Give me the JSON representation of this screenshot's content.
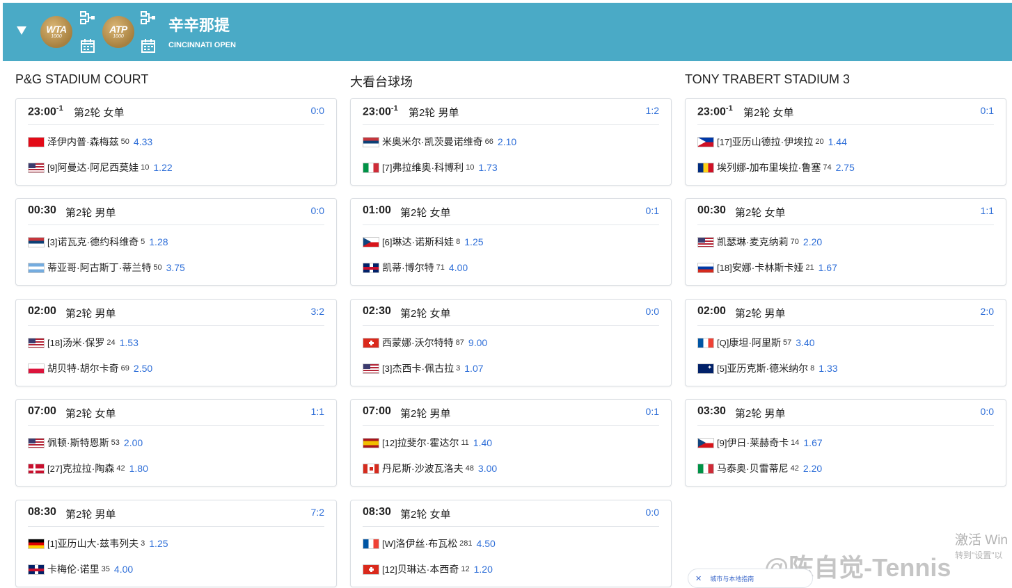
{
  "header": {
    "title": "辛辛那提",
    "subtitle": "CINCINNATI OPEN",
    "badges": [
      {
        "text": "WTA",
        "level": "1000"
      },
      {
        "text": "ATP",
        "level": "1000"
      }
    ]
  },
  "courts": [
    {
      "name": "P&G STADIUM COURT",
      "matches": [
        {
          "time": "23:00",
          "day_offset": "-1",
          "round": "第2轮 女单",
          "score": "0:0",
          "p1": {
            "name": "泽伊内普·森梅兹",
            "seed": "",
            "rank": "50",
            "odds": "4.33",
            "flag": "tr"
          },
          "p2": {
            "name": "阿曼达·阿尼西莫娃",
            "seed": "[9]",
            "rank": "10",
            "odds": "1.22",
            "flag": "us"
          }
        },
        {
          "time": "00:30",
          "day_offset": "",
          "round": "第2轮 男单",
          "score": "0:0",
          "p1": {
            "name": "诺瓦克·德约科维奇",
            "seed": "[3]",
            "rank": "5",
            "odds": "1.28",
            "flag": "rs"
          },
          "p2": {
            "name": "蒂亚哥·阿古斯丁·蒂兰特",
            "seed": "",
            "rank": "50",
            "odds": "3.75",
            "flag": "ar"
          }
        },
        {
          "time": "02:00",
          "day_offset": "",
          "round": "第2轮 男单",
          "score": "3:2",
          "p1": {
            "name": "汤米·保罗",
            "seed": "[18]",
            "rank": "24",
            "odds": "1.53",
            "flag": "us"
          },
          "p2": {
            "name": "胡贝特·胡尔卡奇",
            "seed": "",
            "rank": "69",
            "odds": "2.50",
            "flag": "pl"
          }
        },
        {
          "time": "07:00",
          "day_offset": "",
          "round": "第2轮 女单",
          "score": "1:1",
          "p1": {
            "name": "佩顿·斯特恩斯",
            "seed": "",
            "rank": "53",
            "odds": "2.00",
            "flag": "us"
          },
          "p2": {
            "name": "克拉拉·陶森",
            "seed": "[27]",
            "rank": "42",
            "odds": "1.80",
            "flag": "dk"
          }
        },
        {
          "time": "08:30",
          "day_offset": "",
          "round": "第2轮 男单",
          "score": "7:2",
          "p1": {
            "name": "亚历山大·兹韦列夫",
            "seed": "[1]",
            "rank": "3",
            "odds": "1.25",
            "flag": "de"
          },
          "p2": {
            "name": "卡梅伦·诺里",
            "seed": "",
            "rank": "35",
            "odds": "4.00",
            "flag": "gb"
          }
        }
      ]
    },
    {
      "name": "大看台球场",
      "matches": [
        {
          "time": "23:00",
          "day_offset": "-1",
          "round": "第2轮 男单",
          "score": "1:2",
          "p1": {
            "name": "米奥米尔·凯茨曼诺维奇",
            "seed": "",
            "rank": "66",
            "odds": "2.10",
            "flag": "rs"
          },
          "p2": {
            "name": "弗拉维奥·科博利",
            "seed": "[7]",
            "rank": "10",
            "odds": "1.73",
            "flag": "it"
          }
        },
        {
          "time": "01:00",
          "day_offset": "",
          "round": "第2轮 女单",
          "score": "0:1",
          "p1": {
            "name": "琳达·诺斯科娃",
            "seed": "[6]",
            "rank": "8",
            "odds": "1.25",
            "flag": "cz"
          },
          "p2": {
            "name": "凯蒂·博尔特",
            "seed": "",
            "rank": "71",
            "odds": "4.00",
            "flag": "gb"
          }
        },
        {
          "time": "02:30",
          "day_offset": "",
          "round": "第2轮 女单",
          "score": "0:0",
          "p1": {
            "name": "西蒙娜·沃尔特特",
            "seed": "",
            "rank": "87",
            "odds": "9.00",
            "flag": "ch"
          },
          "p2": {
            "name": "杰西卡·佩古拉",
            "seed": "[3]",
            "rank": "3",
            "odds": "1.07",
            "flag": "us"
          }
        },
        {
          "time": "07:00",
          "day_offset": "",
          "round": "第2轮 男单",
          "score": "0:1",
          "p1": {
            "name": "拉斐尔·霍达尔",
            "seed": "[12]",
            "rank": "11",
            "odds": "1.40",
            "flag": "es"
          },
          "p2": {
            "name": "丹尼斯·沙波瓦洛夫",
            "seed": "",
            "rank": "48",
            "odds": "3.00",
            "flag": "ca"
          }
        },
        {
          "time": "08:30",
          "day_offset": "",
          "round": "第2轮 女单",
          "score": "0:0",
          "p1": {
            "name": "洛伊丝·布瓦松",
            "seed": "[W]",
            "rank": "281",
            "odds": "4.50",
            "flag": "fr"
          },
          "p2": {
            "name": "贝琳达·本西奇",
            "seed": "[12]",
            "rank": "12",
            "odds": "1.20",
            "flag": "ch"
          }
        }
      ]
    },
    {
      "name": "TONY TRABERT STADIUM 3",
      "matches": [
        {
          "time": "23:00",
          "day_offset": "-1",
          "round": "第2轮 女单",
          "score": "0:1",
          "p1": {
            "name": "亚历山德拉·伊埃拉",
            "seed": "[17]",
            "rank": "20",
            "odds": "1.44",
            "flag": "ph"
          },
          "p2": {
            "name": "埃列娜-加布里埃拉·鲁塞",
            "seed": "",
            "rank": "74",
            "odds": "2.75",
            "flag": "ro"
          }
        },
        {
          "time": "00:30",
          "day_offset": "",
          "round": "第2轮 女单",
          "score": "1:1",
          "p1": {
            "name": "凯瑟琳·麦克纳莉",
            "seed": "",
            "rank": "70",
            "odds": "2.20",
            "flag": "us"
          },
          "p2": {
            "name": "安娜·卡林斯卡娅",
            "seed": "[18]",
            "rank": "21",
            "odds": "1.67",
            "flag": "ru"
          }
        },
        {
          "time": "02:00",
          "day_offset": "",
          "round": "第2轮 男单",
          "score": "2:0",
          "p1": {
            "name": "康坦·阿里斯",
            "seed": "[Q]",
            "rank": "57",
            "odds": "3.40",
            "flag": "fr"
          },
          "p2": {
            "name": "亚历克斯·德米纳尔",
            "seed": "[5]",
            "rank": "8",
            "odds": "1.33",
            "flag": "au"
          }
        },
        {
          "time": "03:30",
          "day_offset": "",
          "round": "第2轮 男单",
          "score": "0:0",
          "p1": {
            "name": "伊日·莱赫奇卡",
            "seed": "[9]",
            "rank": "14",
            "odds": "1.67",
            "flag": "cz"
          },
          "p2": {
            "name": "马泰奥·贝雷蒂尼",
            "seed": "",
            "rank": "42",
            "odds": "2.20",
            "flag": "it"
          }
        }
      ]
    }
  ],
  "overlay": {
    "watermark": "@陈自觉-Tennis",
    "activate_windows": "激活 Win",
    "activate_sub": "转到\"设置\"以",
    "toast_text": "城市与本地指南"
  },
  "colors": {
    "header_bg": "#4aaac6",
    "score": "#2f6fd8",
    "odds": "#2f6fd8"
  }
}
